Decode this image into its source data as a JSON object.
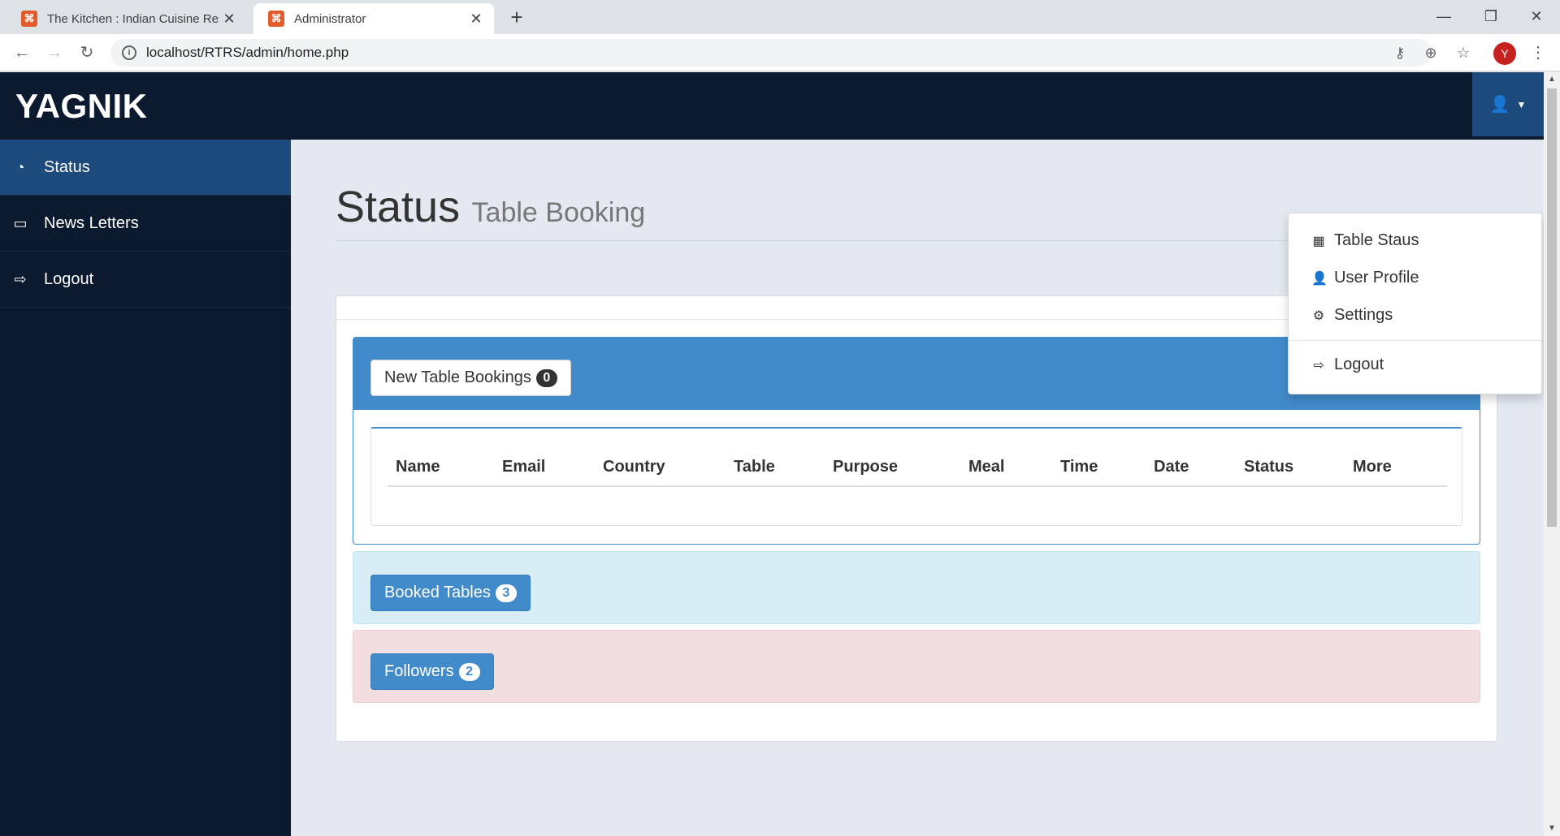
{
  "browser": {
    "tabs": [
      {
        "title": "The Kitchen : Indian Cuisine Resta",
        "close": "✕",
        "favicon": "xampp-icon"
      },
      {
        "title": "Administrator",
        "close": "✕",
        "favicon": "xampp-icon"
      }
    ],
    "new_tab": "+",
    "url": "localhost/RTRS/admin/home.php",
    "profile_initial": "Y"
  },
  "navbar": {
    "brand": "YAGNIK"
  },
  "sidebar": {
    "items": [
      {
        "label": "Status",
        "icon": "dashboard-icon",
        "active": true
      },
      {
        "label": "News Letters",
        "icon": "desktop-icon",
        "active": false
      },
      {
        "label": "Logout",
        "icon": "sign-out-icon",
        "active": false
      }
    ]
  },
  "header": {
    "title": "Status",
    "subtitle": "Table Booking"
  },
  "new_bookings": {
    "label": "New Table Bookings",
    "count": "0",
    "columns": [
      "Name",
      "Email",
      "Country",
      "Table",
      "Purpose",
      "Meal",
      "Time",
      "Date",
      "Status",
      "More"
    ]
  },
  "booked_tables": {
    "label": "Booked Tables",
    "count": "3"
  },
  "followers": {
    "label": "Followers",
    "count": "2"
  },
  "user_menu": {
    "items": [
      {
        "label": "Table Staus",
        "icon": "table-icon"
      },
      {
        "label": "User Profile",
        "icon": "user-icon"
      },
      {
        "label": "Settings",
        "icon": "gear-icon"
      },
      {
        "label": "Logout",
        "icon": "sign-out-icon"
      }
    ]
  },
  "colors": {
    "navbar": "#0b1a2f",
    "accent": "#1c4a7c",
    "primary": "#428bca",
    "info_bg": "#d9edf7",
    "danger_bg": "#f2dede"
  }
}
